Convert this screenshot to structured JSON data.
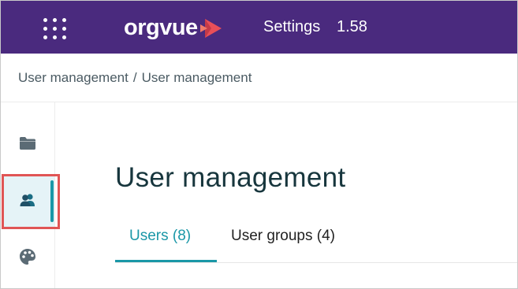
{
  "header": {
    "brand": "orgvue",
    "section": "Settings",
    "version": "1.58",
    "brand_colors": {
      "bar": "#4a2a7e",
      "logo_mark": "#e94f58"
    }
  },
  "breadcrumb": {
    "items": [
      "User management",
      "User management"
    ],
    "separator": "/"
  },
  "sidebar": {
    "items": [
      {
        "name": "folder",
        "icon": "folder-icon",
        "active": false
      },
      {
        "name": "users",
        "icon": "users-icon",
        "active": true
      },
      {
        "name": "palette",
        "icon": "palette-icon",
        "active": false
      }
    ],
    "accent_color": "#1a97a7",
    "highlight_color": "#e05555"
  },
  "main": {
    "title": "User management",
    "tabs": [
      {
        "label": "Users (8)",
        "active": true
      },
      {
        "label": "User groups (4)",
        "active": false
      }
    ]
  }
}
